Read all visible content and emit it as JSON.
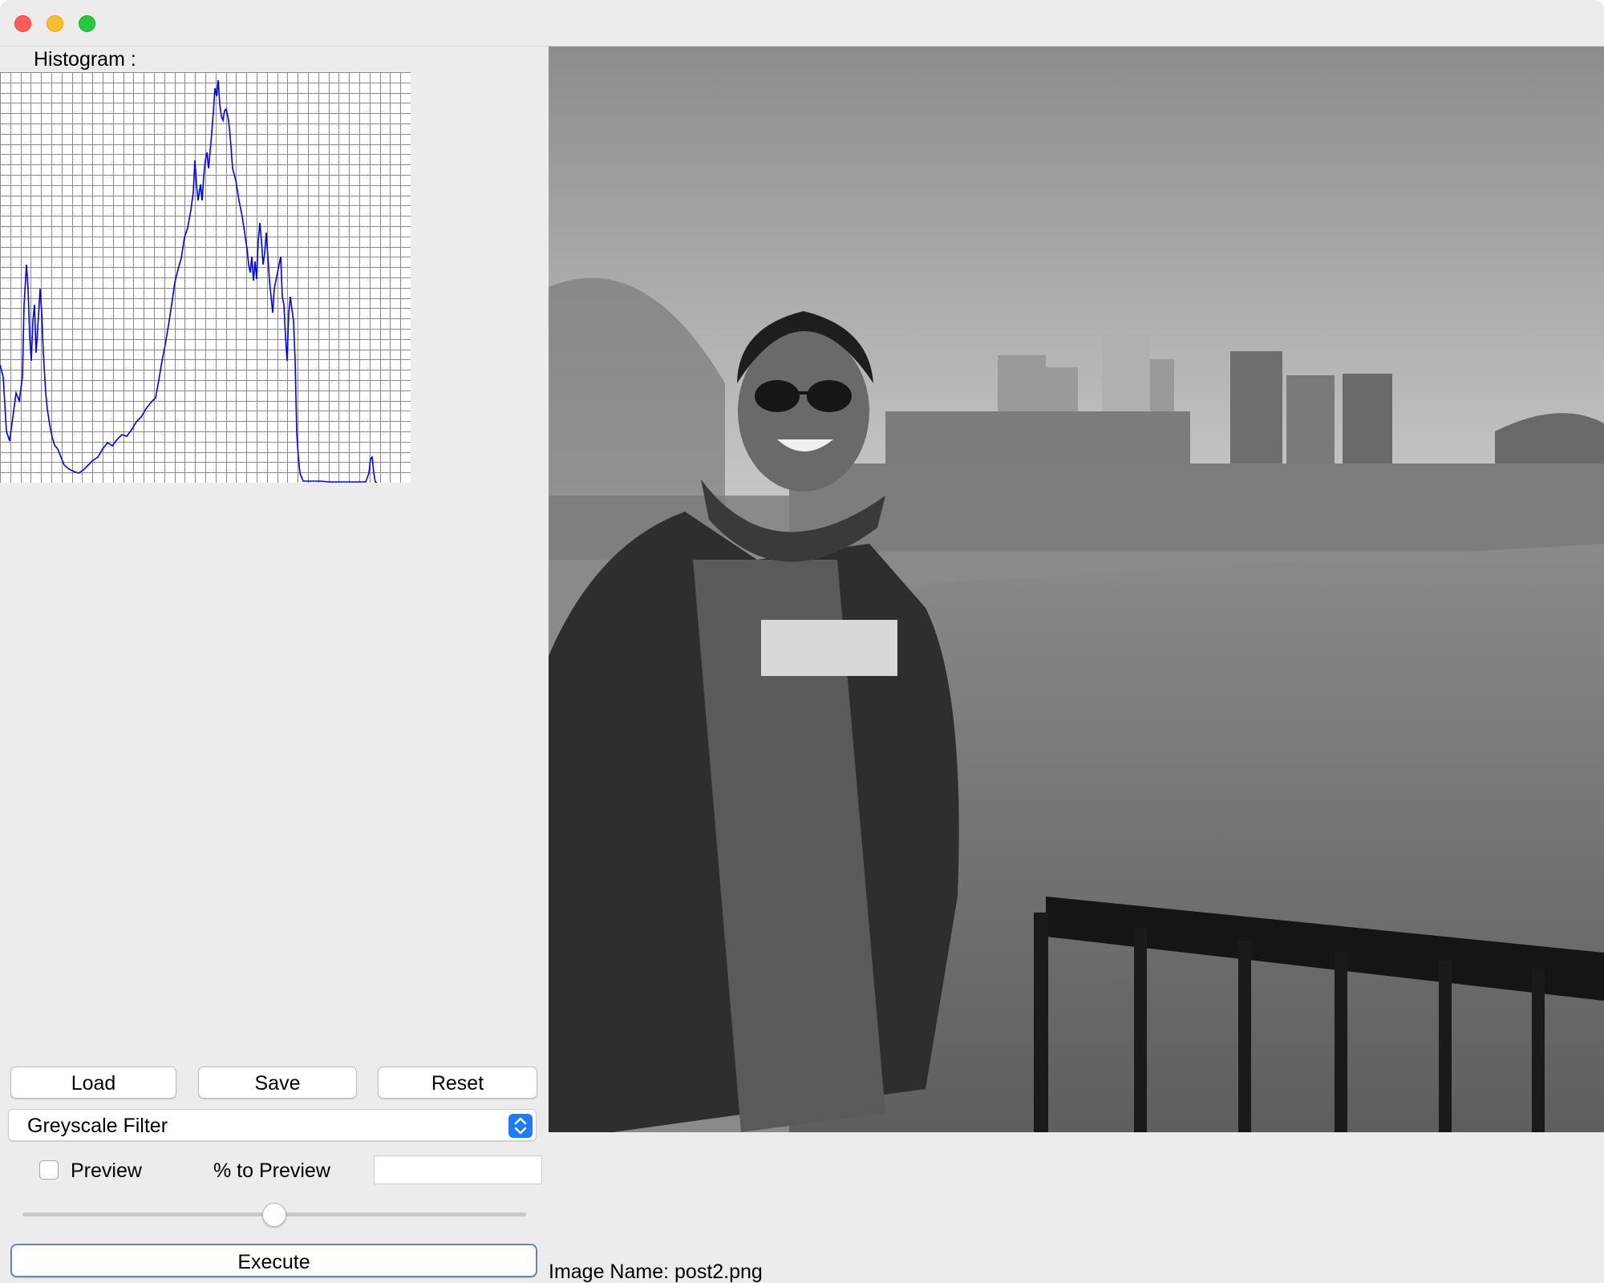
{
  "histogram": {
    "label": "Histogram :",
    "line_color": "#0000ff",
    "grid_color": "#8a8a8a"
  },
  "buttons": {
    "load": "Load",
    "save": "Save",
    "reset": "Reset",
    "execute": "Execute"
  },
  "filter_select": {
    "selected": "Greyscale Filter",
    "accent": "#1f7cf5"
  },
  "preview": {
    "checkbox_label": "Preview",
    "checked": false,
    "percent_label": "% to Preview",
    "percent_value": ""
  },
  "slider": {
    "value_fraction": 0.5
  },
  "image": {
    "name_label": "Image Name: post2.png",
    "mode": "greyscale"
  }
}
